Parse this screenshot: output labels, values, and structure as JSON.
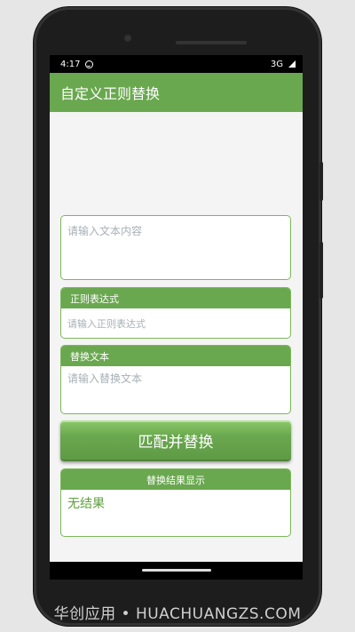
{
  "status_bar": {
    "time": "4:17",
    "network": "3G"
  },
  "app_bar": {
    "title": "自定义正则替换"
  },
  "input_text": {
    "placeholder": "请输入文本内容"
  },
  "regex_group": {
    "header": "正则表达式",
    "placeholder": "请输入正则表达式"
  },
  "replace_group": {
    "header": "替换文本",
    "placeholder": "请输入替换文本"
  },
  "match_button": {
    "label": "匹配并替换"
  },
  "result_group": {
    "header": "替换结果显示",
    "value": "无结果"
  },
  "watermark": {
    "text": "华创应用 • HUACHUANGZS.COM"
  },
  "colors": {
    "accent": "#6aa84f",
    "result_text": "#5ea03c"
  },
  "icons": {
    "status_left": "smiley-icon",
    "status_right": "signal-icon"
  }
}
